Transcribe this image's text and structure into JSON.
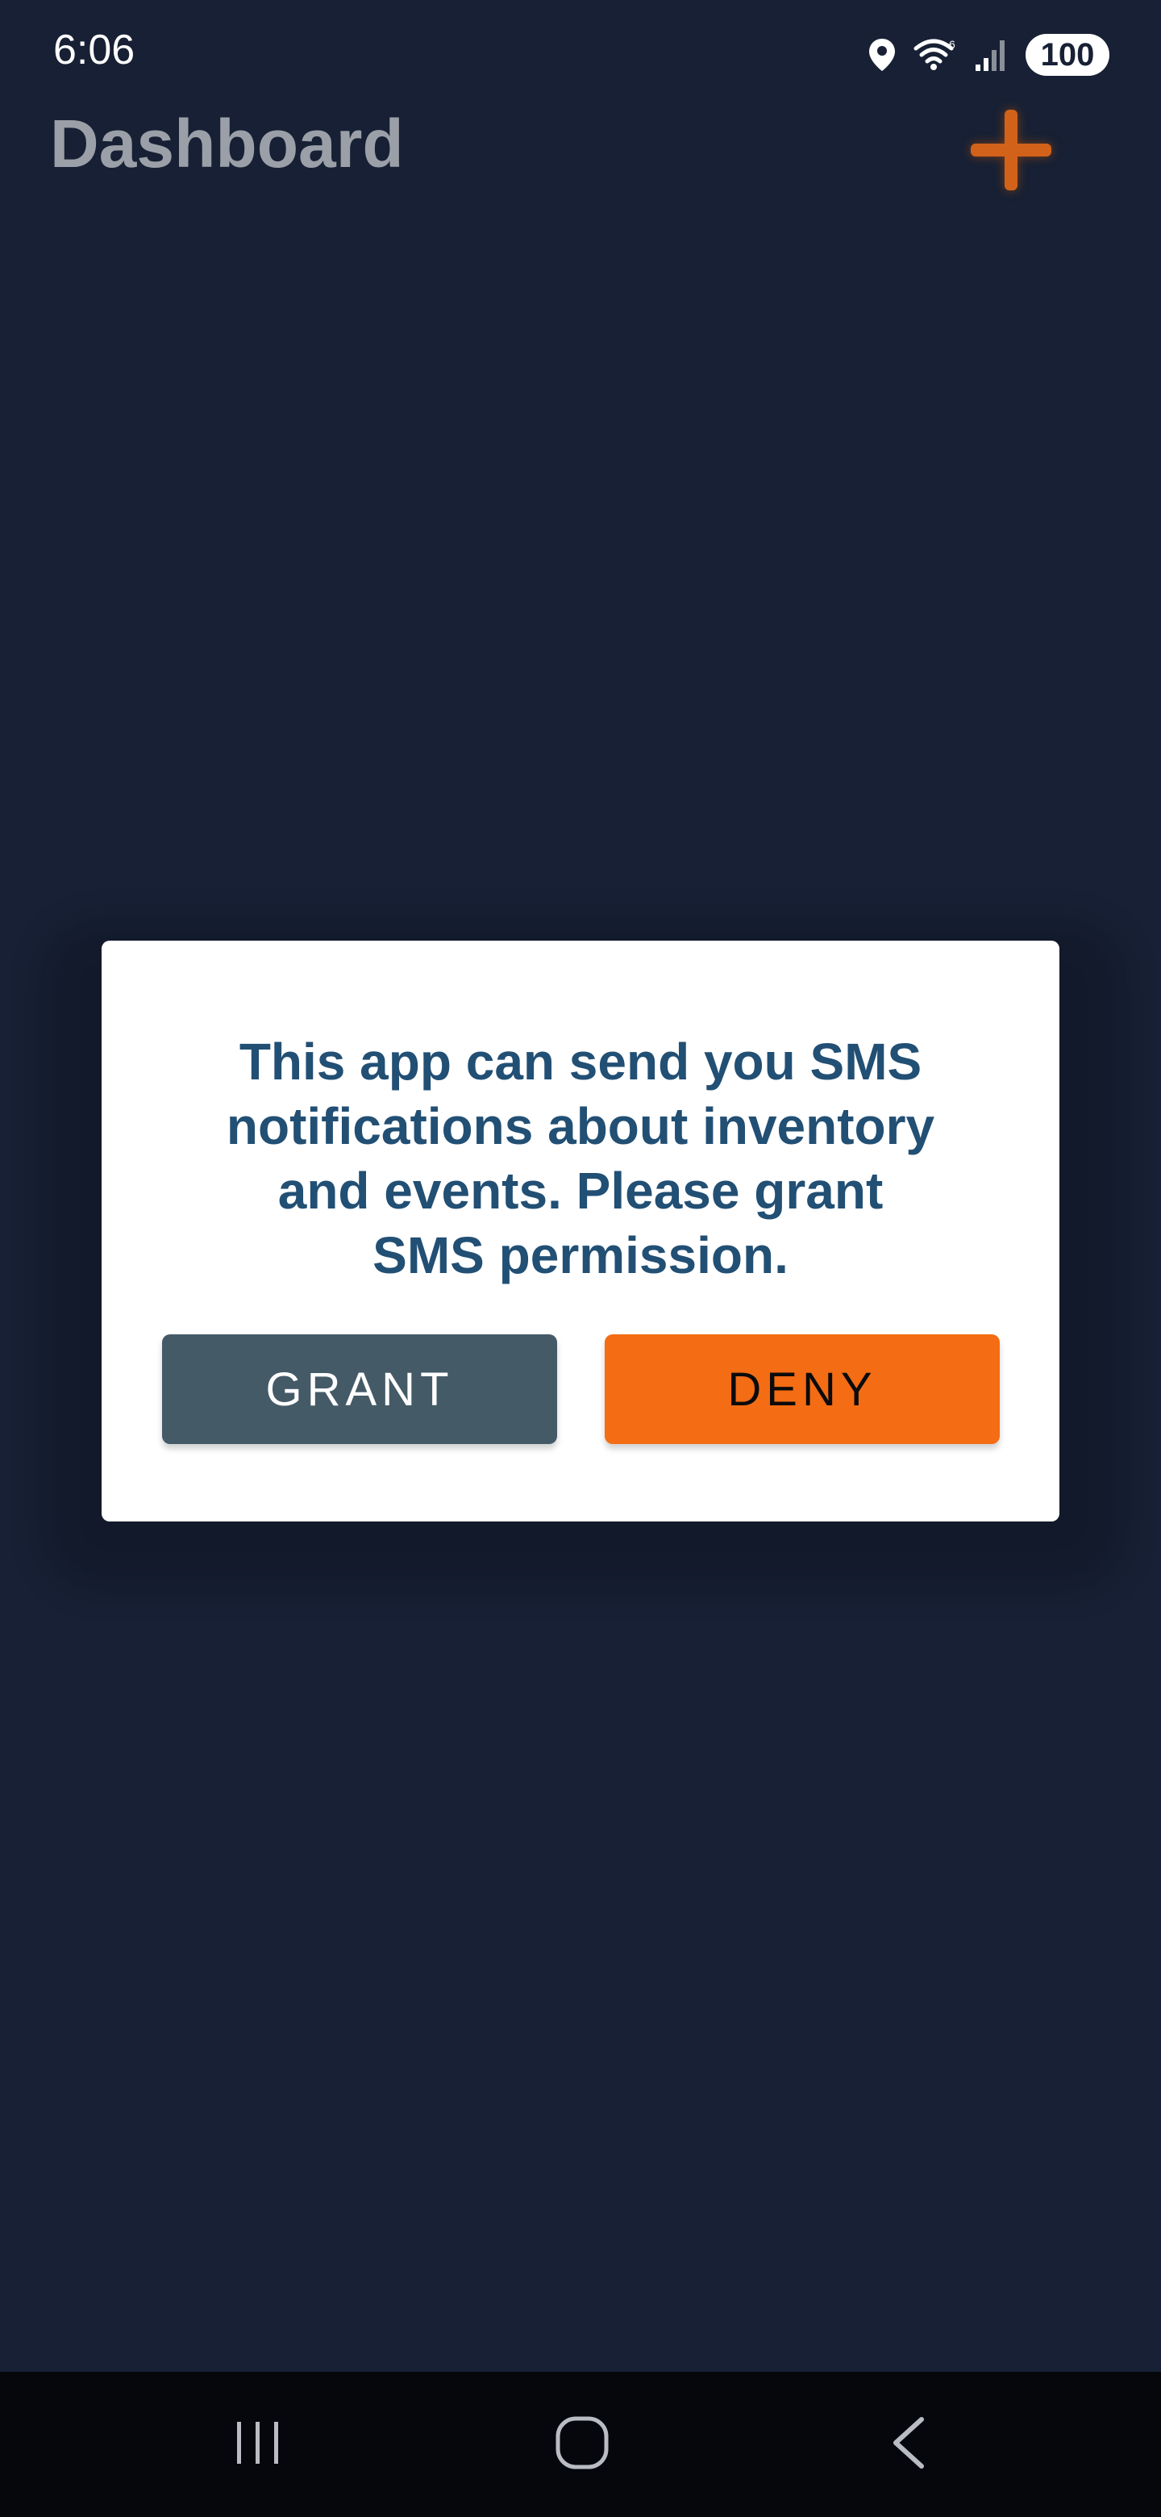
{
  "status_bar": {
    "time": "6:06",
    "battery": "100",
    "icons": [
      "location-icon",
      "wifi-icon",
      "signal-icon",
      "battery-icon"
    ]
  },
  "app_bar": {
    "title": "Dashboard",
    "add_icon": "plus-icon",
    "accent_color": "#d2621a"
  },
  "dialog": {
    "message": "This app can send you SMS notifications about inventory and events. Please grant SMS permission.",
    "grant_label": "GRANT",
    "deny_label": "DENY",
    "grant_color": "#455a67",
    "deny_color": "#f46c14"
  },
  "nav_bar": {
    "items": [
      "recent-apps-icon",
      "home-icon",
      "back-icon"
    ]
  },
  "colors": {
    "background": "#172034",
    "title_text": "#9ba0a8",
    "message_text": "#224f74"
  }
}
